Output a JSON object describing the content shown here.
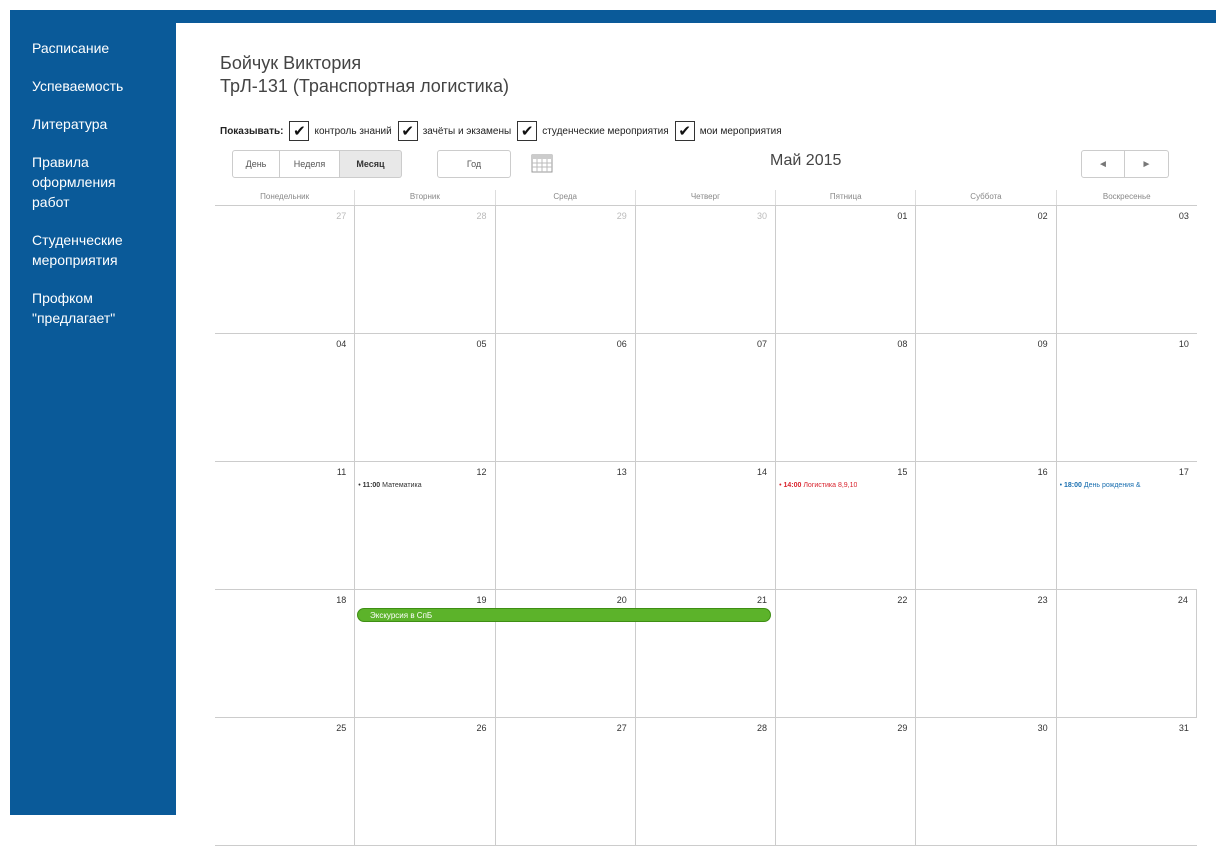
{
  "sidebar": {
    "items": [
      {
        "lines": [
          "Расписание"
        ]
      },
      {
        "lines": [
          "Успеваемость"
        ]
      },
      {
        "lines": [
          "Литература"
        ]
      },
      {
        "lines": [
          "Правила",
          "оформления",
          "работ"
        ]
      },
      {
        "lines": [
          "Студенческие",
          "мероприятия"
        ]
      },
      {
        "lines": [
          "Профком",
          "\"предлагает\""
        ]
      }
    ]
  },
  "header": {
    "name": "Бойчук Виктория",
    "group": "ТрЛ-131 (Транспортная логистика)"
  },
  "filters": {
    "label": "Показывать:",
    "items": [
      {
        "label": "контроль знаний",
        "checked": true
      },
      {
        "label": "зачёты и экзамены",
        "checked": true
      },
      {
        "label": "студенческие мероприятия",
        "checked": true
      },
      {
        "label": "мои мероприятия",
        "checked": true
      }
    ]
  },
  "toolbar": {
    "day": "День",
    "week": "Неделя",
    "month": "Месяц",
    "year": "Год",
    "active_view": "Месяц",
    "title": "Май 2015",
    "prev_icon": "◄",
    "next_icon": "►"
  },
  "calendar": {
    "weekdays": [
      "Понедельник",
      "Вторник",
      "Среда",
      "Четверг",
      "Пятница",
      "Суббота",
      "Воскресенье"
    ],
    "weeks": [
      [
        {
          "d": "27",
          "other": true
        },
        {
          "d": "28",
          "other": true
        },
        {
          "d": "29",
          "other": true
        },
        {
          "d": "30",
          "other": true
        },
        {
          "d": "01"
        },
        {
          "d": "02"
        },
        {
          "d": "03"
        }
      ],
      [
        {
          "d": "04"
        },
        {
          "d": "05"
        },
        {
          "d": "06"
        },
        {
          "d": "07"
        },
        {
          "d": "08"
        },
        {
          "d": "09"
        },
        {
          "d": "10"
        }
      ],
      [
        {
          "d": "11"
        },
        {
          "d": "12",
          "event": {
            "time": "11:00",
            "title": "Математика",
            "color": "#333333"
          }
        },
        {
          "d": "13"
        },
        {
          "d": "14"
        },
        {
          "d": "15",
          "event": {
            "time": "14:00",
            "title": "Логистика 8,9,10",
            "color": "#d9232d"
          }
        },
        {
          "d": "16"
        },
        {
          "d": "17",
          "event": {
            "time": "18:00",
            "title": "День рождения &",
            "color": "#1a6fb0"
          }
        }
      ],
      [
        {
          "d": "18"
        },
        {
          "d": "19"
        },
        {
          "d": "20"
        },
        {
          "d": "21"
        },
        {
          "d": "22"
        },
        {
          "d": "23"
        },
        {
          "d": "24"
        }
      ],
      [
        {
          "d": "25"
        },
        {
          "d": "26"
        },
        {
          "d": "27"
        },
        {
          "d": "28"
        },
        {
          "d": "29"
        },
        {
          "d": "30"
        },
        {
          "d": "31"
        }
      ]
    ],
    "multi_event": {
      "title": "Экскурсия в СпБ",
      "color": "#5cb32a"
    }
  },
  "colors": {
    "sidebar": "#0a5a99",
    "accent_green": "#5cb32a"
  }
}
